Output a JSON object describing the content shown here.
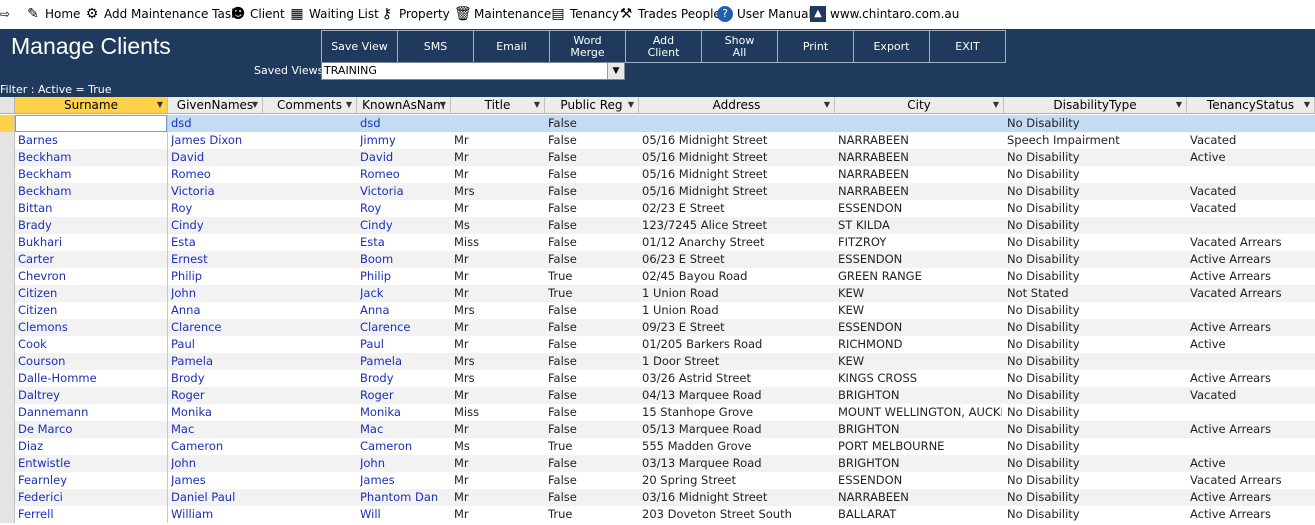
{
  "topbar": {
    "items": [
      {
        "label": "Home",
        "icon": "home-icon"
      },
      {
        "label": "Add Maintenance Task",
        "icon": "maintenance-task-icon"
      },
      {
        "label": "Client",
        "icon": "client-icon"
      },
      {
        "label": "Waiting List",
        "icon": "waiting-list-icon"
      },
      {
        "label": "Property",
        "icon": "key-icon"
      },
      {
        "label": "Maintenance",
        "icon": "trash-icon"
      },
      {
        "label": "Tenancy",
        "icon": "tenancy-icon"
      },
      {
        "label": "Trades People",
        "icon": "trades-people-icon"
      },
      {
        "label": "User Manual",
        "icon": "help-icon"
      },
      {
        "label": "www.chintaro.com.au",
        "icon": "website-icon"
      }
    ]
  },
  "header": {
    "title": "Manage Clients",
    "buttons": [
      "Save View",
      "SMS",
      "Email",
      "Word\nMerge",
      "Add\nClient",
      "Show\nAll",
      "Print",
      "Export",
      "EXIT"
    ],
    "saved_views_label": "Saved Views:",
    "saved_views_value": "TRAINING",
    "filter": "Filter : Active = True"
  },
  "colors": {
    "header_bg": "#1f3a5c",
    "accent": "#ffd24a",
    "link": "#1a2fb8",
    "selected_row": "#c4dcf3"
  },
  "columns": [
    "Surname",
    "GivenNames",
    "Comments",
    "KnownAsNam",
    "Title",
    "Public Reg",
    "Address",
    "City",
    "DisabilityType",
    "TenancyStatus"
  ],
  "rows": [
    [
      "",
      "dsd",
      "",
      "dsd",
      "",
      "False",
      "",
      "",
      "No Disability",
      ""
    ],
    [
      "Barnes",
      "James Dixon",
      "",
      "Jimmy",
      "Mr",
      "False",
      "05/16 Midnight Street",
      "NARRABEEN",
      "Speech Impairment",
      "Vacated"
    ],
    [
      "Beckham",
      "David",
      "",
      "David",
      "Mr",
      "False",
      "05/16 Midnight Street",
      "NARRABEEN",
      "No Disability",
      "Active"
    ],
    [
      "Beckham",
      "Romeo",
      "",
      "Romeo",
      "Mr",
      "False",
      "05/16 Midnight Street",
      "NARRABEEN",
      "No Disability",
      ""
    ],
    [
      "Beckham",
      "Victoria",
      "",
      "Victoria",
      "Mrs",
      "False",
      "05/16 Midnight Street",
      "NARRABEEN",
      "No Disability",
      "Vacated"
    ],
    [
      "Bittan",
      "Roy",
      "",
      "Roy",
      "Mr",
      "False",
      "02/23 E Street",
      "ESSENDON",
      "No Disability",
      "Vacated"
    ],
    [
      "Brady",
      "Cindy",
      "",
      "Cindy",
      "Ms",
      "False",
      "123/7245 Alice Street",
      "ST KILDA",
      "No Disability",
      ""
    ],
    [
      "Bukhari",
      "Esta",
      "",
      "Esta",
      "Miss",
      "False",
      "01/12 Anarchy Street",
      "FITZROY",
      "No Disability",
      "Vacated Arrears"
    ],
    [
      "Carter",
      "Ernest",
      "",
      "Boom",
      "Mr",
      "False",
      "06/23 E Street",
      "ESSENDON",
      "No Disability",
      "Active Arrears"
    ],
    [
      "Chevron",
      "Philip",
      "",
      "Philip",
      "Mr",
      "True",
      "02/45 Bayou Road",
      "GREEN RANGE",
      "No Disability",
      "Active Arrears"
    ],
    [
      "Citizen",
      "John",
      "",
      "Jack",
      "Mr",
      "True",
      "1 Union Road",
      "KEW",
      "Not Stated",
      "Vacated Arrears"
    ],
    [
      "Citizen",
      "Anna",
      "",
      "Anna",
      "Mrs",
      "False",
      "1 Union Road",
      "KEW",
      "No Disability",
      ""
    ],
    [
      "Clemons",
      "Clarence",
      "",
      "Clarence",
      "Mr",
      "False",
      "09/23 E Street",
      "ESSENDON",
      "No Disability",
      "Active Arrears"
    ],
    [
      "Cook",
      "Paul",
      "",
      "Paul",
      "Mr",
      "False",
      "01/205 Barkers Road",
      "RICHMOND",
      "No Disability",
      "Active"
    ],
    [
      "Courson",
      "Pamela",
      "",
      "Pamela",
      "Mrs",
      "False",
      "1 Door Street",
      "KEW",
      "No Disability",
      ""
    ],
    [
      "Dalle-Homme",
      "Brody",
      "",
      "Brody",
      "Mrs",
      "False",
      "03/26 Astrid Street",
      "KINGS CROSS",
      "No Disability",
      "Active Arrears"
    ],
    [
      "Daltrey",
      "Roger",
      "",
      "Roger",
      "Mr",
      "False",
      "04/13 Marquee Road",
      "BRIGHTON",
      "No Disability",
      "Vacated"
    ],
    [
      "Dannemann",
      "Monika",
      "",
      "Monika",
      "Miss",
      "False",
      "15 Stanhope Grove",
      "MOUNT WELLINGTON, AUCKLA",
      "No Disability",
      ""
    ],
    [
      "De Marco",
      "Mac",
      "",
      "Mac",
      "Mr",
      "False",
      "05/13 Marquee Road",
      "BRIGHTON",
      "No Disability",
      "Active Arrears"
    ],
    [
      "Diaz",
      "Cameron",
      "",
      "Cameron",
      "Ms",
      "True",
      "555 Madden Grove",
      "PORT MELBOURNE",
      "No Disability",
      ""
    ],
    [
      "Entwistle",
      "John",
      "",
      "John",
      "Mr",
      "False",
      "03/13 Marquee Road",
      "BRIGHTON",
      "No Disability",
      "Active"
    ],
    [
      "Fearnley",
      "James",
      "",
      "James",
      "Mr",
      "False",
      "20 Spring Street",
      "ESSENDON",
      "No Disability",
      "Vacated Arrears"
    ],
    [
      "Federici",
      "Daniel Paul",
      "",
      "Phantom Dan",
      "Mr",
      "False",
      "03/16 Midnight Street",
      "NARRABEEN",
      "No Disability",
      "Active Arrears"
    ],
    [
      "Ferrell",
      "William",
      "",
      "Will",
      "Mr",
      "True",
      "203 Doveton Street South",
      "BALLARAT",
      "No Disability",
      "Active Arrears"
    ]
  ]
}
